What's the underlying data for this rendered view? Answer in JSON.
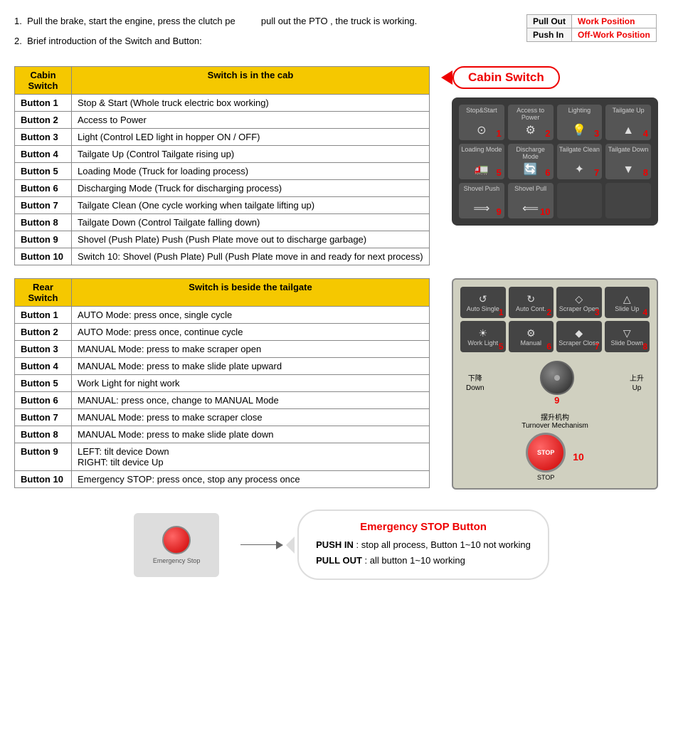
{
  "page": {
    "intro": {
      "step1": "Pull the brake, start the engine, press the clutch pe",
      "step1b": "pull out the PTO , the truck is working.",
      "step2": "Brief introduction of the Switch and Button:"
    },
    "pto_table": {
      "rows": [
        {
          "col1": "Pull Out",
          "col2": "Work Position"
        },
        {
          "col1": "Push In",
          "col2": "Off-Work Position"
        }
      ]
    },
    "cabin_switch": {
      "header1": "Cabin Switch",
      "header2": "Switch is in the cab",
      "bubble_label": "Cabin  Switch",
      "buttons": [
        {
          "id": "Button 1",
          "desc": "Stop & Start (Whole truck electric box working)",
          "icon": "⊙",
          "label": "Stop&Start",
          "number": "1"
        },
        {
          "id": "Button 2",
          "desc": "Access to Power",
          "icon": "⚙",
          "label": "Access to Power",
          "number": "2"
        },
        {
          "id": "Button 3",
          "desc": "Light (Control LED light in hopper ON / OFF)",
          "icon": "💡",
          "label": "Lighting",
          "number": "3"
        },
        {
          "id": "Button 4",
          "desc": "Tailgate Up (Control Tailgate rising up)",
          "icon": "▲",
          "label": "Tailgate Up",
          "number": "4"
        },
        {
          "id": "Button 5",
          "desc": "Loading Mode (Truck for loading process)",
          "icon": "🚛",
          "label": "Loading Mode",
          "number": "5"
        },
        {
          "id": "Button 6",
          "desc": "Discharging Mode (Truck for discharging process)",
          "icon": "🔄",
          "label": "Discharge Mode",
          "number": "6"
        },
        {
          "id": "Button 7",
          "desc": "Tailgate Clean (One cycle working when tailgate lifting up)",
          "icon": "✦",
          "label": "Tailgate Clean",
          "number": "7"
        },
        {
          "id": "Button 8",
          "desc": "Tailgate Down (Control Tailgate falling down)",
          "icon": "▼",
          "label": "Tailgate Down",
          "number": "8"
        },
        {
          "id": "Button 9",
          "desc": "Shovel (Push Plate) Push (Push Plate move out to discharge garbage)",
          "icon": "⟹",
          "label": "Shovel Push",
          "number": "9"
        },
        {
          "id": "Button 10",
          "desc": "Switch 10: Shovel (Push Plate) Pull (Push Plate move in and ready for next process)",
          "icon": "⟸",
          "label": "Shovel Pull",
          "number": "10"
        }
      ]
    },
    "rear_switch": {
      "header1": "Rear Switch",
      "header2": "Switch is beside the tailgate",
      "buttons": [
        {
          "id": "Button 1",
          "desc": "AUTO Mode: press once, single cycle",
          "icon": "↺",
          "label": "Auto Single",
          "number": "1"
        },
        {
          "id": "Button 2",
          "desc": "AUTO Mode: press once, continue cycle",
          "icon": "↻",
          "label": "Auto Cont.",
          "number": "2"
        },
        {
          "id": "Button 3",
          "desc": "MANUAL Mode: press to make scraper open",
          "icon": "◇",
          "label": "Scraper Open",
          "number": "3"
        },
        {
          "id": "Button 4",
          "desc": "MANUAL Mode: press to make slide plate upward",
          "icon": "△",
          "label": "Slide Up",
          "number": "4"
        },
        {
          "id": "Button 5",
          "desc": "Work Light for night work",
          "icon": "☀",
          "label": "Work Light",
          "number": "5"
        },
        {
          "id": "Button 6",
          "desc": "MANUAL: press once, change to MANUAL Mode",
          "icon": "⚙",
          "label": "Manual",
          "number": "6"
        },
        {
          "id": "Button 7",
          "desc": "MANUAL Mode: press to make scraper close",
          "icon": "◆",
          "label": "Scraper Close",
          "number": "7"
        },
        {
          "id": "Button 8",
          "desc": "MANUAL Mode: press to make slide plate down",
          "icon": "▽",
          "label": "Slide Down",
          "number": "8"
        }
      ],
      "knob": {
        "down_label": "下降\nDown",
        "up_label": "上升\nUp",
        "number": "9",
        "title1": "摆升机构",
        "title2": "Turnover Mechanism"
      },
      "emergency": {
        "number": "10",
        "label": "STOP"
      }
    },
    "emergency_stop": {
      "title": "Emergency  STOP Button",
      "push_in": "PUSH IN",
      "push_in_desc": ": stop all process, Button 1~10 not working",
      "pull_out": "PULL OUT",
      "pull_out_desc": ": all button 1~10 working"
    }
  }
}
